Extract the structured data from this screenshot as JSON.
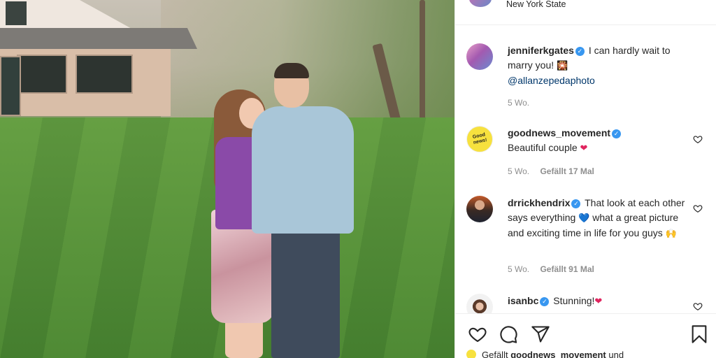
{
  "post": {
    "location": "New York State"
  },
  "comments": [
    {
      "username": "jenniferkgates",
      "text": "I can hardly wait to marry you!",
      "emoji": "🎇",
      "mention": "@allanzepedaphoto",
      "age": "5 Wo."
    },
    {
      "username": "goodnews_movement",
      "avatar_text": "Good news!",
      "text": "Beautiful couple",
      "emoji": "❤",
      "age": "5 Wo.",
      "likes": "Gefällt 17 Mal"
    },
    {
      "username": "drrickhendrix",
      "text": "That look at each other says everything",
      "emoji_mid": "💙",
      "text_2": "what a great picture and exciting time in life for you guys",
      "emoji_end": "🙌",
      "age": "5 Wo.",
      "likes": "Gefällt 91 Mal"
    },
    {
      "username": "isanbc",
      "text": "Stunning!",
      "emoji": "❤"
    }
  ],
  "footer": {
    "likes_prefix": "Gefällt",
    "likes_user": "goodnews_movement",
    "likes_suffix": "und"
  },
  "icons": {
    "like": "heart-outline-icon",
    "comment": "comment-bubble-icon",
    "share": "paper-plane-icon",
    "save": "bookmark-icon"
  },
  "colors": {
    "verified": "#3897f0",
    "mention": "#00376b",
    "meta": "#8e8e8e"
  }
}
